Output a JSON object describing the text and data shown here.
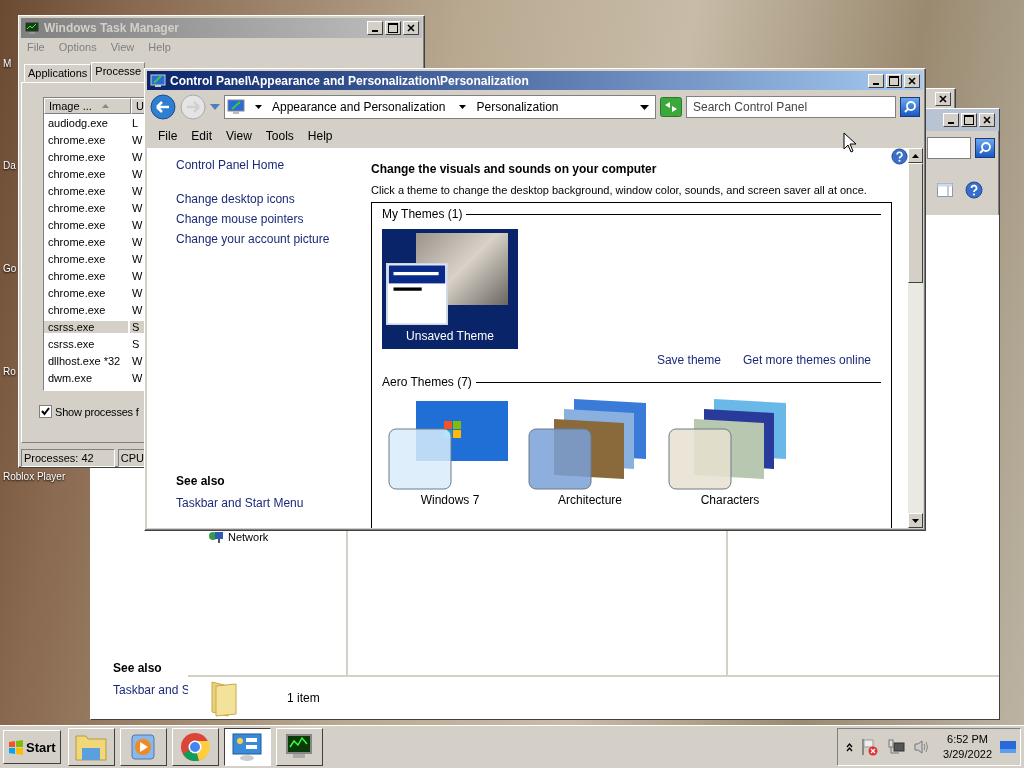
{
  "desktop": {
    "icon_labels": [
      "M",
      "Da",
      "Go",
      "Ro",
      "Roblox Player"
    ]
  },
  "task_manager": {
    "title": "Windows Task Manager",
    "menu": [
      "File",
      "Options",
      "View",
      "Help"
    ],
    "tabs": [
      {
        "label": "Applications",
        "selected": false
      },
      {
        "label": "Processe",
        "selected": true
      }
    ],
    "columns": [
      "Image ...",
      "U"
    ],
    "rows": [
      {
        "image": "audiodg.exe",
        "column_2": "L",
        "selected": false
      },
      {
        "image": "chrome.exe",
        "column_2": "W",
        "selected": false
      },
      {
        "image": "chrome.exe",
        "column_2": "W",
        "selected": false
      },
      {
        "image": "chrome.exe",
        "column_2": "W",
        "selected": false
      },
      {
        "image": "chrome.exe",
        "column_2": "W",
        "selected": false
      },
      {
        "image": "chrome.exe",
        "column_2": "W",
        "selected": false
      },
      {
        "image": "chrome.exe",
        "column_2": "W",
        "selected": false
      },
      {
        "image": "chrome.exe",
        "column_2": "W",
        "selected": false
      },
      {
        "image": "chrome.exe",
        "column_2": "W",
        "selected": false
      },
      {
        "image": "chrome.exe",
        "column_2": "W",
        "selected": false
      },
      {
        "image": "chrome.exe",
        "column_2": "W",
        "selected": false
      },
      {
        "image": "chrome.exe",
        "column_2": "W",
        "selected": false
      },
      {
        "image": "csrss.exe",
        "column_2": "S",
        "selected": true
      },
      {
        "image": "csrss.exe",
        "column_2": "S",
        "selected": false
      },
      {
        "image": "dllhost.exe *32",
        "column_2": "W",
        "selected": false
      },
      {
        "image": "dwm.exe",
        "column_2": "W",
        "selected": false
      }
    ],
    "show_all": {
      "label": "Show processes f",
      "checked": true
    },
    "status": [
      "Processes: 42",
      "CPU"
    ]
  },
  "explorer": {
    "see_also": "See also",
    "links": [
      "Taskbar and S"
    ],
    "nav_items": [
      "Network"
    ],
    "status": "1 item"
  },
  "control_panel": {
    "title": "Control Panel\\Appearance and Personalization\\Personalization",
    "breadcrumbs": [
      "Appearance and Personalization",
      "Personalization"
    ],
    "search": {
      "placeholder": "Search Control Panel"
    },
    "menu": [
      "File",
      "Edit",
      "View",
      "Tools",
      "Help"
    ],
    "side_links": [
      "Control Panel Home",
      "Change desktop icons",
      "Change mouse pointers",
      "Change your account picture"
    ],
    "see_also": {
      "heading": "See also",
      "links": [
        "Taskbar and Start Menu"
      ]
    },
    "heading": "Change the visuals and sounds on your computer",
    "description": "Click a theme to change the desktop background, window color, sounds, and screen saver all at once.",
    "groups": [
      {
        "title": "My Themes (1)",
        "themes": [
          {
            "name": "Unsaved Theme",
            "kind": "custom",
            "selected": true
          }
        ],
        "links": [
          "Save theme",
          "Get more themes online"
        ]
      },
      {
        "title": "Aero Themes (7)",
        "themes": [
          {
            "name": "Windows 7",
            "kind": "single",
            "selected": false
          },
          {
            "name": "Architecture",
            "kind": "stack",
            "selected": false
          },
          {
            "name": "Characters",
            "kind": "stack",
            "selected": false
          }
        ]
      }
    ]
  },
  "taskbar": {
    "start": "Start",
    "buttons": [
      {
        "kind": "folder",
        "selected": false
      },
      {
        "kind": "media",
        "selected": false
      },
      {
        "kind": "browser",
        "selected": false
      },
      {
        "kind": "control-panel",
        "selected": true
      },
      {
        "kind": "monitor",
        "selected": false
      }
    ],
    "clock": {
      "time": "6:52 PM",
      "date": "3/29/2022"
    }
  }
}
